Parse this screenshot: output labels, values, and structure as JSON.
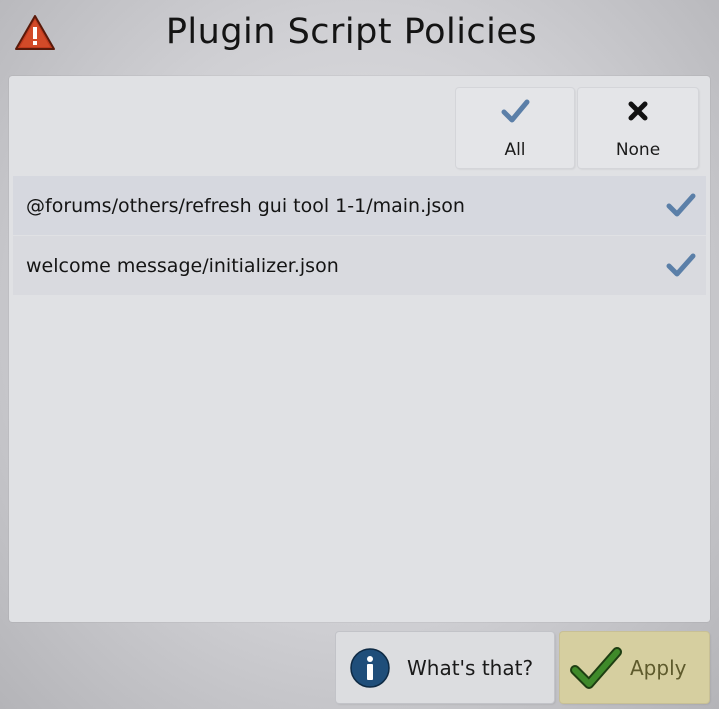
{
  "dialog": {
    "title": "Plugin Script Policies"
  },
  "toggles": {
    "all_label": "All",
    "none_label": "None"
  },
  "scripts": [
    {
      "path": "@forums/others/refresh gui tool 1-1/main.json",
      "allowed": true
    },
    {
      "path": "welcome message/initializer.json",
      "allowed": true
    }
  ],
  "footer": {
    "whats_that_label": "What's that?",
    "apply_label": "Apply"
  },
  "colors": {
    "check_blue": "#5b7fa8",
    "apply_bg": "#d6cfa0",
    "apply_text": "#5e5a2c",
    "apply_check": "#3f8a2a",
    "warning_red": "#c03a1e",
    "info_blue": "#1f4e7a"
  },
  "icons": {
    "title": "warning-icon",
    "all": "check-icon",
    "none": "x-icon",
    "row": "check-icon",
    "whats_that": "info-icon",
    "apply": "check-icon"
  }
}
